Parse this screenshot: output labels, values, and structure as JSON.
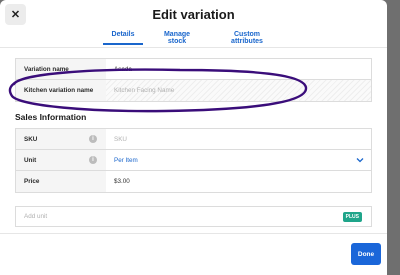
{
  "modal": {
    "title": "Edit variation",
    "close_symbol": "✕"
  },
  "tabs": [
    {
      "label": "Details",
      "active": true
    },
    {
      "label": "Manage stock",
      "active": false
    },
    {
      "label": "Custom attributes",
      "active": false
    }
  ],
  "details": {
    "variation_name_label": "Variation name",
    "variation_name_value": "Asada",
    "kitchen_name_label": "Kitchen variation name",
    "kitchen_name_placeholder": "Kitchen Facing Name"
  },
  "sales": {
    "section_title": "Sales Information",
    "sku_label": "SKU",
    "sku_placeholder": "SKU",
    "unit_label": "Unit",
    "unit_value": "Per Item",
    "price_label": "Price",
    "price_value": "$3.00",
    "info_icon_symbol": "i"
  },
  "add_unit": {
    "placeholder": "Add unit",
    "badge": "PLUS"
  },
  "footer": {
    "done_label": "Done"
  },
  "colors": {
    "accent": "#1a66cc",
    "done_button": "#1a66d9",
    "plus_badge": "#1fa58a",
    "annotation_ink": "#3a0d7a"
  },
  "icons": {
    "close": "close-icon",
    "info": "info-icon",
    "chevron": "chevron-down-icon"
  }
}
